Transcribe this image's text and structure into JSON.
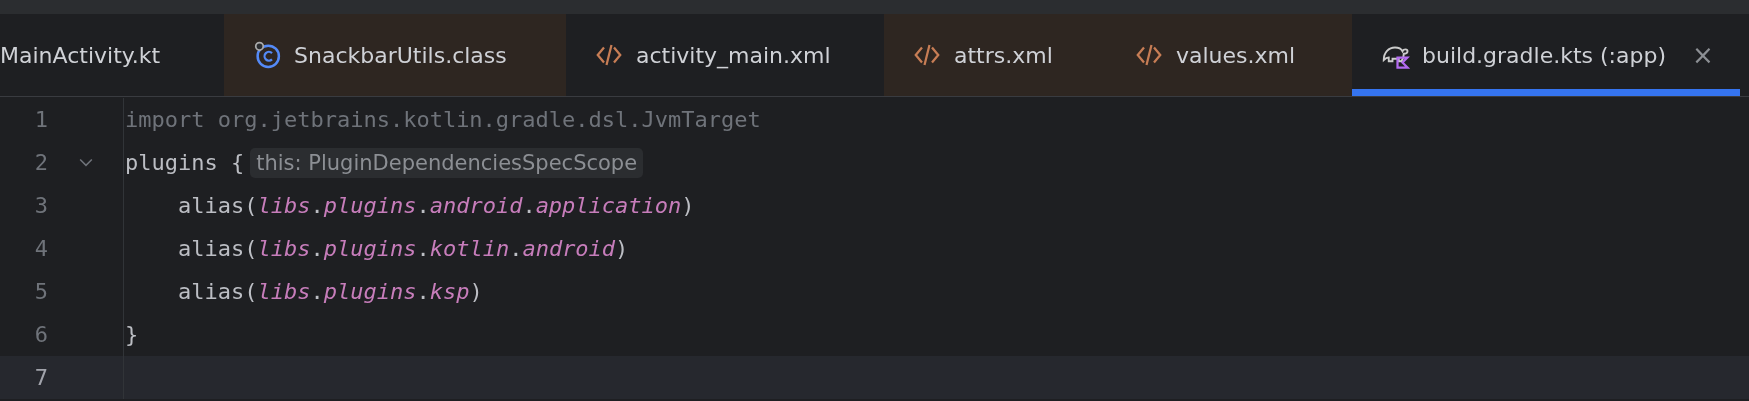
{
  "tabs": [
    {
      "label": "MainActivity.kt",
      "kind": "none",
      "tinted": false,
      "selected": false
    },
    {
      "label": "SnackbarUtils.class",
      "kind": "class",
      "tinted": true,
      "selected": false
    },
    {
      "label": "activity_main.xml",
      "kind": "xml",
      "tinted": false,
      "selected": false
    },
    {
      "label": "attrs.xml",
      "kind": "xml",
      "tinted": true,
      "selected": false
    },
    {
      "label": "values.xml",
      "kind": "xml",
      "tinted": true,
      "selected": false
    },
    {
      "label": "build.gradle.kts (:app)",
      "kind": "gradle",
      "tinted": false,
      "selected": true,
      "close": "×"
    }
  ],
  "editor": {
    "lines": [
      {
        "number": "1",
        "current": false,
        "fold": false,
        "tokens": [
          {
            "text": "import org.jetbrains.kotlin.gradle.dsl.JvmTarget",
            "kind": "unused"
          }
        ]
      },
      {
        "number": "2",
        "current": false,
        "fold": true,
        "tokens": [
          {
            "text": "plugins {",
            "kind": "plain"
          }
        ],
        "hint": "this: PluginDependenciesSpecScope"
      },
      {
        "number": "3",
        "current": false,
        "fold": false,
        "tokens": [
          {
            "text": "    alias(",
            "kind": "plain"
          },
          {
            "text": "libs",
            "kind": "property"
          },
          {
            "text": ".",
            "kind": "plain"
          },
          {
            "text": "plugins",
            "kind": "property"
          },
          {
            "text": ".",
            "kind": "plain"
          },
          {
            "text": "android",
            "kind": "property"
          },
          {
            "text": ".",
            "kind": "plain"
          },
          {
            "text": "application",
            "kind": "property"
          },
          {
            "text": ")",
            "kind": "plain"
          }
        ]
      },
      {
        "number": "4",
        "current": false,
        "fold": false,
        "tokens": [
          {
            "text": "    alias(",
            "kind": "plain"
          },
          {
            "text": "libs",
            "kind": "property"
          },
          {
            "text": ".",
            "kind": "plain"
          },
          {
            "text": "plugins",
            "kind": "property"
          },
          {
            "text": ".",
            "kind": "plain"
          },
          {
            "text": "kotlin",
            "kind": "property"
          },
          {
            "text": ".",
            "kind": "plain"
          },
          {
            "text": "android",
            "kind": "property"
          },
          {
            "text": ")",
            "kind": "plain"
          }
        ]
      },
      {
        "number": "5",
        "current": false,
        "fold": false,
        "tokens": [
          {
            "text": "    alias(",
            "kind": "plain"
          },
          {
            "text": "libs",
            "kind": "property"
          },
          {
            "text": ".",
            "kind": "plain"
          },
          {
            "text": "plugins",
            "kind": "property"
          },
          {
            "text": ".",
            "kind": "plain"
          },
          {
            "text": "ksp",
            "kind": "property"
          },
          {
            "text": ")",
            "kind": "plain"
          }
        ]
      },
      {
        "number": "6",
        "current": false,
        "fold": false,
        "tokens": [
          {
            "text": "}",
            "kind": "plain"
          }
        ]
      },
      {
        "number": "7",
        "current": true,
        "fold": false
      }
    ]
  }
}
